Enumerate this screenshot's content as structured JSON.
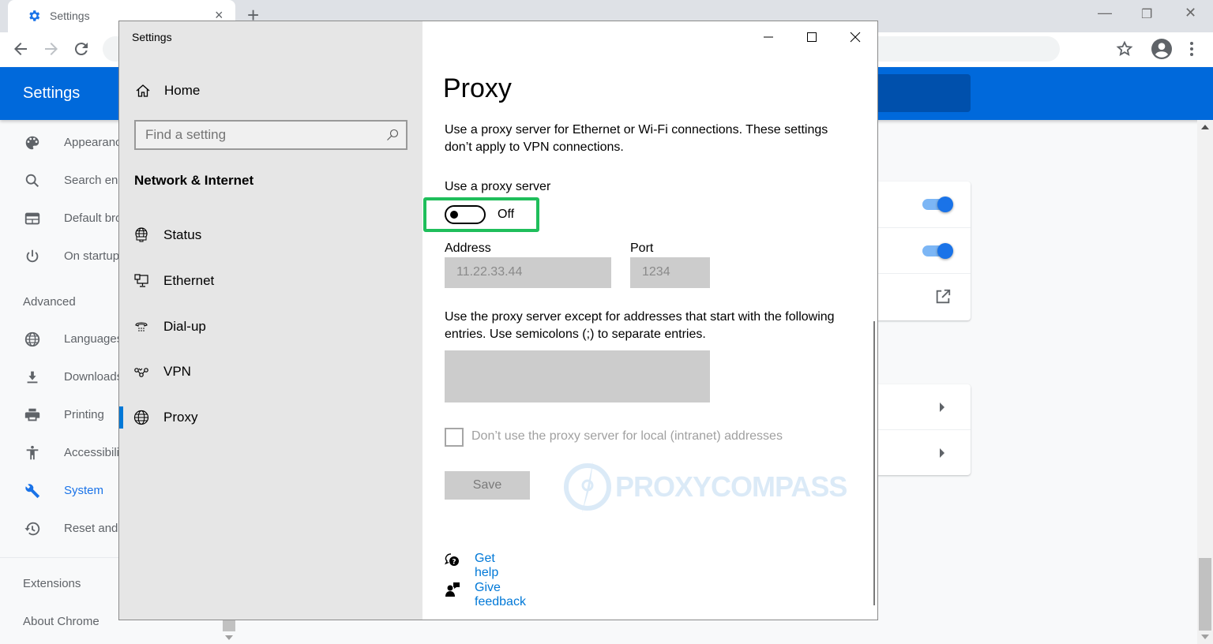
{
  "browser": {
    "tab_title": "Settings",
    "new_tab_symbol": "+",
    "tab_close_symbol": "×",
    "window_controls": {
      "minimize": "—",
      "restore": "❐",
      "close": "✕"
    },
    "header_title": "Settings",
    "colors": {
      "header": "#0069db",
      "accent": "#1a73e8"
    }
  },
  "chrome_nav": {
    "items": [
      {
        "label": "Appearance",
        "icon": "palette-icon"
      },
      {
        "label": "Search engine",
        "icon": "search-icon"
      },
      {
        "label": "Default browser",
        "icon": "browser-icon"
      },
      {
        "label": "On startup",
        "icon": "power-icon"
      }
    ],
    "advanced_label": "Advanced",
    "advanced_items": [
      {
        "label": "Languages",
        "icon": "globe-icon"
      },
      {
        "label": "Downloads",
        "icon": "download-icon"
      },
      {
        "label": "Printing",
        "icon": "printer-icon"
      },
      {
        "label": "Accessibility",
        "icon": "accessibility-icon"
      },
      {
        "label": "System",
        "icon": "wrench-icon",
        "active": true
      },
      {
        "label": "Reset and clean up",
        "icon": "restore-icon"
      }
    ],
    "extensions_label": "Extensions",
    "about_label": "About Chrome"
  },
  "chrome_cards": {
    "toggles": [
      {
        "state": "on"
      },
      {
        "state": "on"
      }
    ]
  },
  "win_settings": {
    "app_title": "Settings",
    "home_label": "Home",
    "search_placeholder": "Find a setting",
    "category": "Network & Internet",
    "nav": [
      {
        "label": "Status",
        "icon": "network-status-icon"
      },
      {
        "label": "Ethernet",
        "icon": "ethernet-icon"
      },
      {
        "label": "Dial-up",
        "icon": "dialup-icon"
      },
      {
        "label": "VPN",
        "icon": "vpn-icon"
      },
      {
        "label": "Proxy",
        "icon": "globe-icon",
        "active": true
      }
    ],
    "page_title": "Proxy",
    "description": "Use a proxy server for Ethernet or Wi-Fi connections. These settings don’t apply to VPN connections.",
    "use_proxy_label": "Use a proxy server",
    "use_proxy_state": "Off",
    "address_label": "Address",
    "address_value": "11.22.33.44",
    "port_label": "Port",
    "port_value": "1234",
    "exceptions_description": "Use the proxy server except for addresses that start with the following entries. Use semicolons (;) to separate entries.",
    "exceptions_value": "",
    "local_checkbox_label": "Don’t use the proxy server for local (intranet) addresses",
    "local_checkbox_checked": false,
    "save_label": "Save",
    "get_help_label": "Get help",
    "give_feedback_label": "Give feedback",
    "watermark": "PROXYCOMPASS",
    "highlight_color": "#1fbe5b",
    "link_color": "#0078d7"
  }
}
